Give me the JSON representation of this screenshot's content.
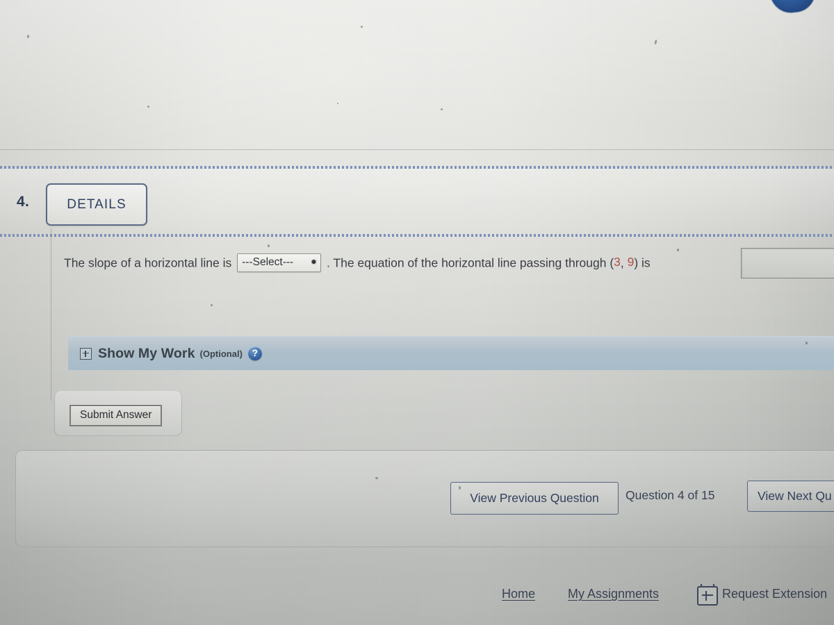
{
  "question": {
    "number_label": "4.",
    "details_label": "DETAILS",
    "text_before_select": "The slope of a horizontal line is",
    "select_value": "---Select---",
    "select_chevron": "chevron-down-icon",
    "text_after_select": ". The equation of the horizontal line passing through (",
    "point_x": "3",
    "point_separator": ", ",
    "point_y": "9",
    "text_tail": ") is",
    "answer_value": "",
    "answer_placeholder": ""
  },
  "show_my_work": {
    "expand_icon": "plus-box-icon",
    "title": "Show My Work",
    "optional_label": "(Optional)",
    "help_icon": "help-circle-icon",
    "help_glyph": "?"
  },
  "submit": {
    "label": "Submit Answer"
  },
  "navigation": {
    "previous_label": "View Previous Question",
    "counter": "Question 4 of 15",
    "next_label": "View Next Qu"
  },
  "footer": {
    "home_label": "Home",
    "assignments_label": "My Assignments",
    "extension_icon": "calendar-plus-icon",
    "extension_label": "Request Extension"
  },
  "colors": {
    "accent_blue": "#2f5a94",
    "value_red": "#b05048",
    "nav_border": "#556481",
    "band_blue": "#a8bcc9"
  }
}
